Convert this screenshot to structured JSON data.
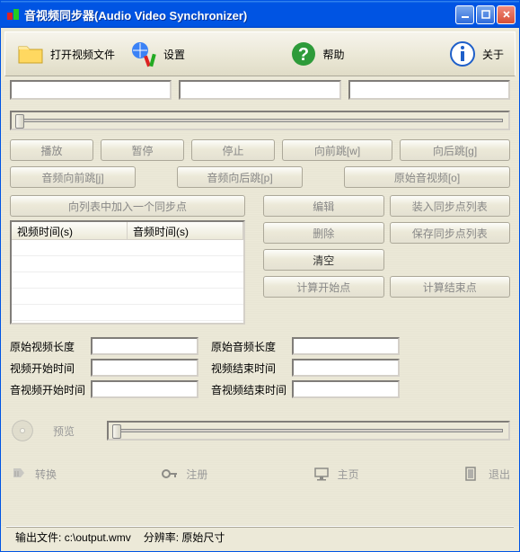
{
  "window": {
    "title": "音视频同步器(Audio Video Synchronizer)"
  },
  "toolbar": {
    "open": "打开视频文件",
    "settings": "设置",
    "help": "帮助",
    "about": "关于"
  },
  "fields": {
    "f1": "",
    "f2": "",
    "f3": ""
  },
  "playback": {
    "play": "播放",
    "pause": "暂停",
    "stop": "停止",
    "fwd": "向前跳[w]",
    "back": "向后跳[g]"
  },
  "audio": {
    "afwd": "音频向前跳[j]",
    "aback": "音频向后跳[p]",
    "orig": "原始音视频[o]"
  },
  "sync": {
    "add_point": "向列表中加入一个同步点"
  },
  "table": {
    "col_video": "视频时间(s)",
    "col_audio": "音频时间(s)"
  },
  "ops": {
    "edit": "编辑",
    "load": "装入同步点列表",
    "del": "删除",
    "save": "保存同步点列表",
    "clear": "清空",
    "calc_start": "计算开始点",
    "calc_end": "计算结束点"
  },
  "info": {
    "orig_video_len": "原始视频长度",
    "orig_audio_len": "原始音频长度",
    "video_start": "视频开始时间",
    "video_end": "视频结束时间",
    "av_start": "音视频开始时间",
    "av_end": "音视频结束时间",
    "v1": "",
    "v2": "",
    "v3": "",
    "v4": "",
    "v5": "",
    "v6": ""
  },
  "preview": {
    "label": "预览"
  },
  "bottom": {
    "convert": "转换",
    "register": "注册",
    "home": "主页",
    "exit": "退出"
  },
  "status": {
    "out_label": "输出文件:",
    "out_path": "c:\\output.wmv",
    "res_label": "分辨率:",
    "res_value": "原始尺寸"
  }
}
